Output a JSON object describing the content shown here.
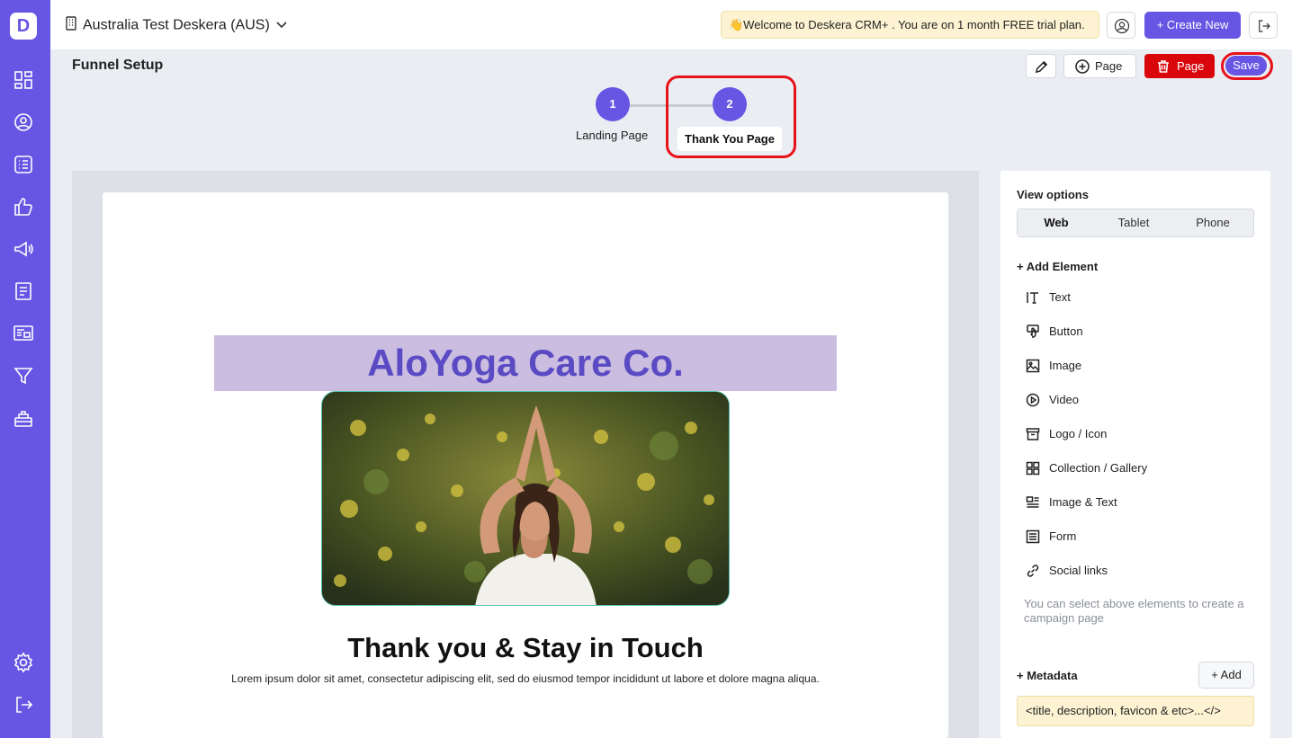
{
  "sidebar": {
    "logo": "D",
    "icons": [
      "dashboard-icon",
      "contacts-icon",
      "deals-icon",
      "likes-icon",
      "campaign-icon",
      "forms-icon",
      "landing-page-icon",
      "funnel-icon",
      "helpdesk-icon",
      "settings-icon",
      "logout-icon"
    ]
  },
  "header": {
    "org_name": "Australia Test Deskera (AUS)",
    "welcome": "👋Welcome to Deskera CRM+ . You are on 1 month FREE trial plan.",
    "create_new": "+ Create New"
  },
  "toolbar": {
    "title": "Funnel Setup",
    "add_page": "Page",
    "delete_page": "Page",
    "save": "Save"
  },
  "stepper": {
    "steps": [
      {
        "number": "1",
        "label": "Landing Page"
      },
      {
        "number": "2",
        "label": "Thank You Page"
      }
    ],
    "active_step": 2
  },
  "canvas": {
    "brand": "AloYoga Care Co.",
    "heading": "Thank you & Stay in Touch",
    "body": "Lorem ipsum dolor sit amet, consectetur adipiscing elit, sed do eiusmod tempor incididunt ut labore et dolore magna aliqua."
  },
  "panel": {
    "view_options_label": "View options",
    "view_tabs": [
      "Web",
      "Tablet",
      "Phone"
    ],
    "active_view": "Web",
    "add_element_label": "+ Add Element",
    "elements": [
      "Text",
      "Button",
      "Image",
      "Video",
      "Logo / Icon",
      "Collection / Gallery",
      "Image & Text",
      "Form",
      "Social links"
    ],
    "hint": "You can select above elements to create a campaign page",
    "metadata_label": "+ Metadata",
    "add_label": "+ Add",
    "metadata_placeholder": "<title, description, favicon & etc>...</>"
  },
  "colors": {
    "primary": "#6755e3",
    "danger": "#d9070c",
    "highlight_ring": "#e8121a",
    "brand_banner": "#cbbde0"
  }
}
